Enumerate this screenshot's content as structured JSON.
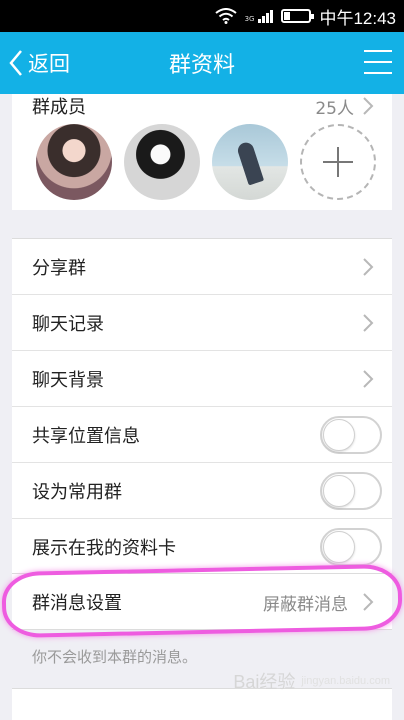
{
  "status_bar": {
    "time": "中午12:43",
    "network": "3G"
  },
  "header": {
    "back_label": "返回",
    "title": "群资料"
  },
  "members": {
    "title": "群成员",
    "count": "25人"
  },
  "rows": [
    {
      "label": "分享群"
    },
    {
      "label": "聊天记录"
    },
    {
      "label": "聊天背景"
    },
    {
      "label": "共享位置信息",
      "toggle": false
    },
    {
      "label": "设为常用群",
      "toggle": false
    },
    {
      "label": "展示在我的资料卡",
      "toggle": false
    },
    {
      "label": "群消息设置",
      "value": "屏蔽群消息"
    }
  ],
  "note": "你不会收到本群的消息。",
  "watermark": {
    "text": "Bai经验",
    "sub": "jingyan.baidu.com"
  },
  "colors": {
    "nav_bg": "#13b1e6",
    "highlight": "#ee5ce0",
    "background": "#efeff4"
  }
}
